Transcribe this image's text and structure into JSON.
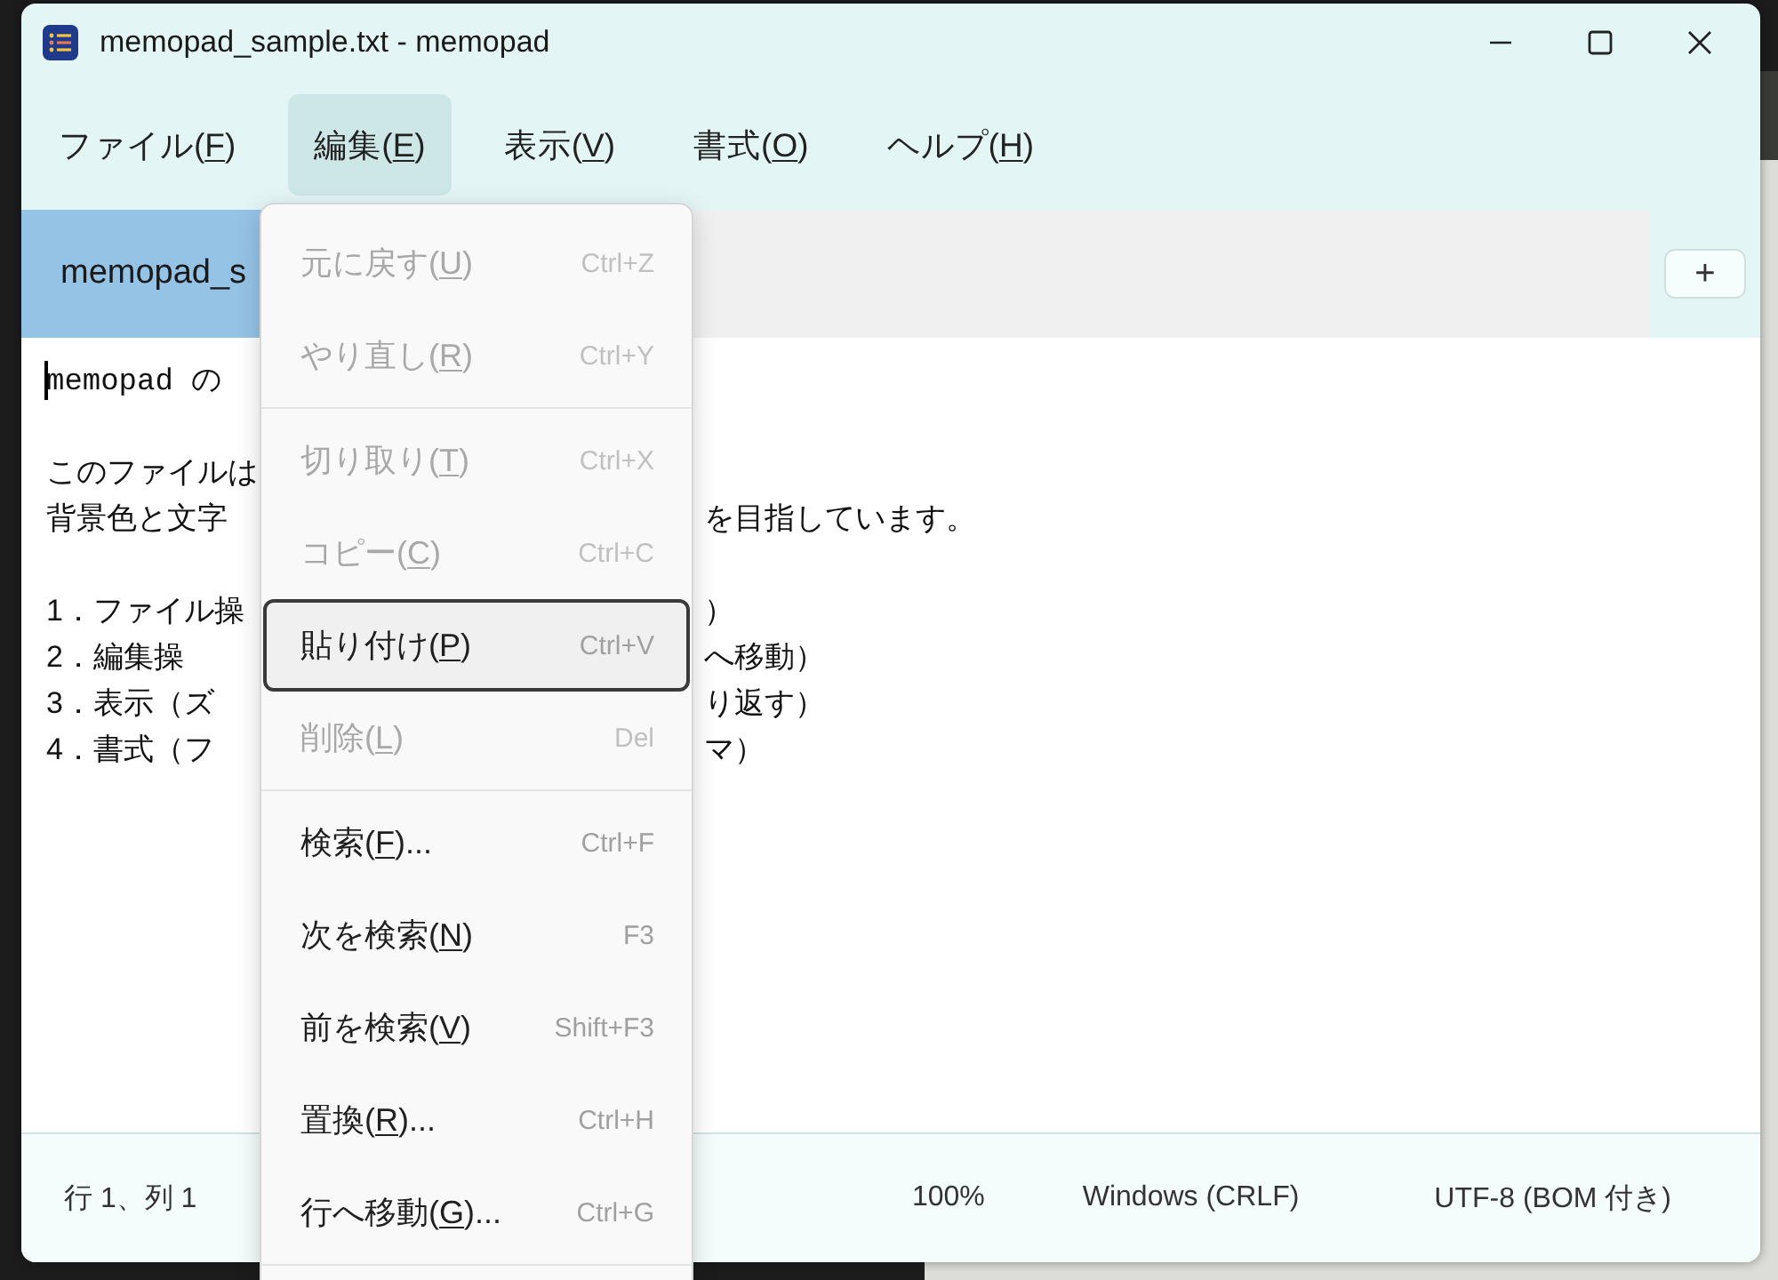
{
  "window": {
    "title": "memopad_sample.txt - memopad"
  },
  "menu_bar": [
    {
      "before": "ファイル(",
      "key": "F",
      "after": ")",
      "selected": false
    },
    {
      "before": "編集(",
      "key": "E",
      "after": ")",
      "selected": true
    },
    {
      "before": "表示(",
      "key": "V",
      "after": ")",
      "selected": false
    },
    {
      "before": "書式(",
      "key": "O",
      "after": ")",
      "selected": false
    },
    {
      "before": "ヘルプ(",
      "key": "H",
      "after": ")",
      "selected": false
    }
  ],
  "tabs": [
    {
      "label": "memopad_s",
      "selected": true
    }
  ],
  "new_tab_button": "+",
  "editor": {
    "lines": [
      {
        "kind": "text",
        "left": "memopad の"
      },
      {
        "kind": "blank"
      },
      {
        "kind": "text",
        "left": "このファイルは"
      },
      {
        "kind": "text",
        "left": "背景色と文字",
        "right": "を目指しています。"
      },
      {
        "kind": "blank"
      },
      {
        "kind": "text",
        "left": "1．ファイル操",
        "right": "）"
      },
      {
        "kind": "text",
        "left": "2．編集操",
        "right": "へ移動）"
      },
      {
        "kind": "text",
        "left": "3．表示（ズ",
        "right": "り返す）"
      },
      {
        "kind": "text",
        "left": "4．書式（フ",
        "right": "マ）"
      }
    ]
  },
  "edit_menu": {
    "items": [
      {
        "kind": "item",
        "before": "元に戻す(",
        "key": "U",
        "after": ")",
        "shortcut": "Ctrl+Z",
        "disabled": true,
        "selected": false
      },
      {
        "kind": "item",
        "before": "やり直し(",
        "key": "R",
        "after": ")",
        "shortcut": "Ctrl+Y",
        "disabled": true,
        "selected": false
      },
      {
        "kind": "separator"
      },
      {
        "kind": "item",
        "before": "切り取り(",
        "key": "T",
        "after": ")",
        "shortcut": "Ctrl+X",
        "disabled": true,
        "selected": false
      },
      {
        "kind": "item",
        "before": "コピー(",
        "key": "C",
        "after": ")",
        "shortcut": "Ctrl+C",
        "disabled": true,
        "selected": false
      },
      {
        "kind": "item",
        "before": "貼り付け(",
        "key": "P",
        "after": ")",
        "shortcut": "Ctrl+V",
        "disabled": false,
        "selected": true
      },
      {
        "kind": "item",
        "before": "削除(",
        "key": "L",
        "after": ")",
        "shortcut": "Del",
        "disabled": true,
        "selected": false
      },
      {
        "kind": "separator"
      },
      {
        "kind": "item",
        "before": "検索(",
        "key": "F",
        "after": ")...",
        "shortcut": "Ctrl+F",
        "disabled": false,
        "selected": false
      },
      {
        "kind": "item",
        "before": "次を検索(",
        "key": "N",
        "after": ")",
        "shortcut": "F3",
        "disabled": false,
        "selected": false
      },
      {
        "kind": "item",
        "before": "前を検索(",
        "key": "V",
        "after": ")",
        "shortcut": "Shift+F3",
        "disabled": false,
        "selected": false
      },
      {
        "kind": "item",
        "before": "置換(",
        "key": "R",
        "after": ")...",
        "shortcut": "Ctrl+H",
        "disabled": false,
        "selected": false
      },
      {
        "kind": "item",
        "before": "行へ移動(",
        "key": "G",
        "after": ")...",
        "shortcut": "Ctrl+G",
        "disabled": false,
        "selected": false
      },
      {
        "kind": "separator"
      }
    ]
  },
  "status_bar": {
    "position": "行 1、列 1",
    "zoom": "100%",
    "line_ending": "Windows (CRLF)",
    "encoding": "UTF-8 (BOM 付き)"
  }
}
